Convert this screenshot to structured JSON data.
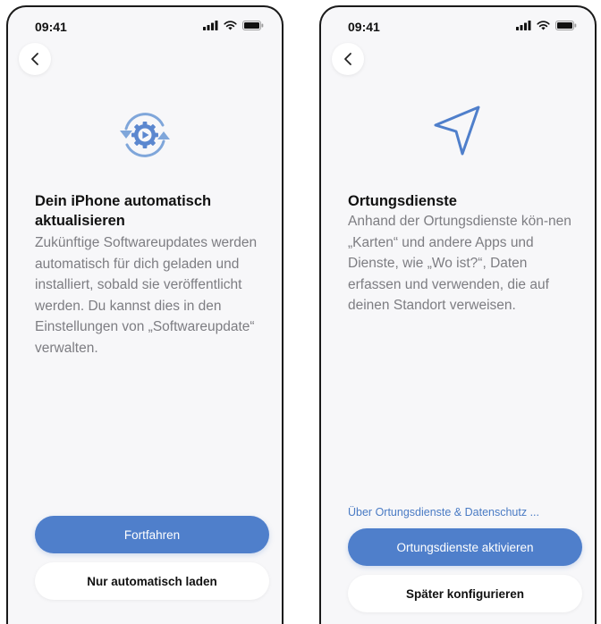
{
  "colors": {
    "accent": "#4f7fcb",
    "link": "#4a7bc4",
    "body_text": "#7d7d82",
    "title_text": "#111111",
    "screen_bg": "#f7f7f9"
  },
  "screens": [
    {
      "status_time": "09:41",
      "status_icons": [
        "cellular-signal-icon",
        "wifi-icon",
        "battery-icon"
      ],
      "back_icon": "chevron-left-icon",
      "hero_icon": "software-update-gear-icon",
      "title_line1": "Dein iPhone automatisch",
      "title_line2": "aktualisieren",
      "body": "Zukünftige Softwareupdates werden automatisch für dich geladen und installiert, sobald sie veröffentlicht werden. Du kannst dies in den Einstellungen von „Softwareupdate“ verwalten.",
      "primary_button": "Fortfahren",
      "secondary_button": "Nur automatisch laden"
    },
    {
      "status_time": "09:41",
      "status_icons": [
        "cellular-signal-icon",
        "wifi-icon",
        "battery-icon"
      ],
      "back_icon": "chevron-left-icon",
      "hero_icon": "location-arrow-icon",
      "title": "Ortungsdienste",
      "body": "Anhand der Ortungsdienste kön-nen „Karten“ und andere Apps und Dienste, wie „Wo ist?“, Daten erfassen und verwenden, die auf deinen Standort verweisen.",
      "info_link": "Über Ortungsdienste & Datenschutz ...",
      "primary_button": "Ortungsdienste aktivieren",
      "secondary_button": "Später konfigurieren"
    }
  ]
}
